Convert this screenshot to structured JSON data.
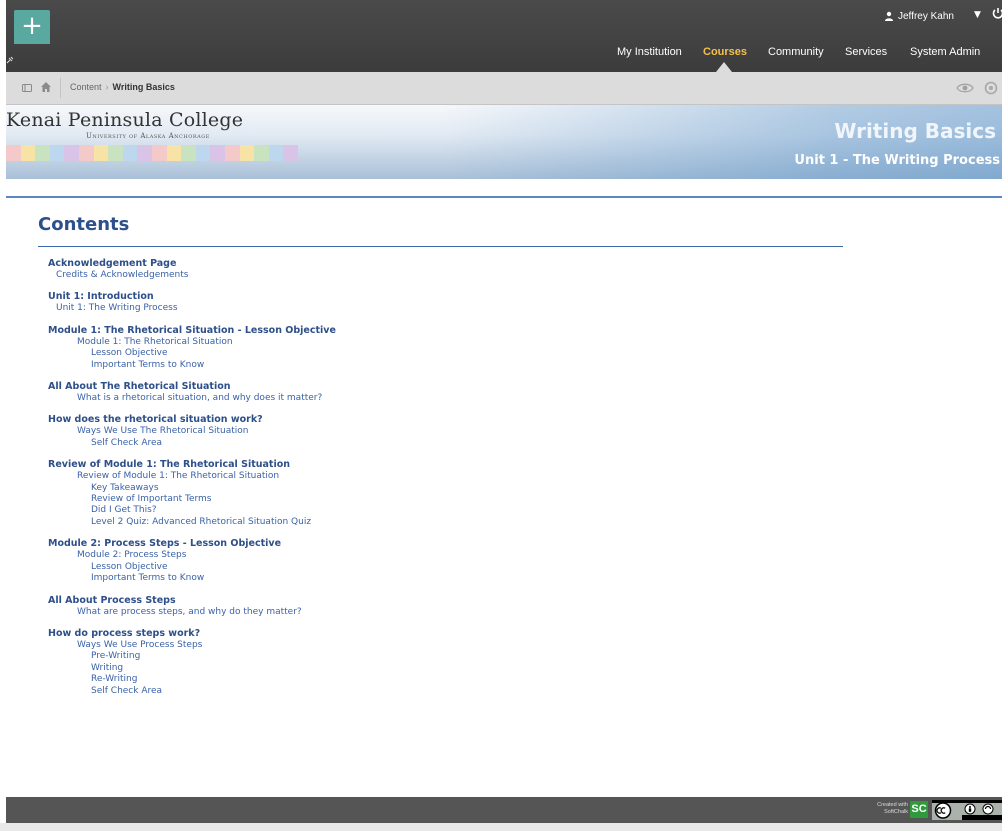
{
  "user": {
    "name": "Jeffrey Kahn"
  },
  "nav": {
    "tabs": [
      {
        "label": "My Institution",
        "active": false
      },
      {
        "label": "Courses",
        "active": true
      },
      {
        "label": "Community",
        "active": false
      },
      {
        "label": "Services",
        "active": false
      },
      {
        "label": "System Admin",
        "active": false
      }
    ]
  },
  "breadcrumb": {
    "parent": "Content",
    "separator": "›",
    "current": "Writing Basics"
  },
  "banner": {
    "college_name": "Kenai Peninsula College",
    "college_subtitle": "University of Alaska Anchorage",
    "course_title": "Writing Basics",
    "unit_title": "Unit 1 - The Writing Process",
    "strip_colors": [
      "#f4c9c9",
      "#f7e3a6",
      "#c9e3c0",
      "#bcd7ee",
      "#d9c3e6",
      "#f4c9c9",
      "#f7e3a6",
      "#c9e3c0",
      "#bcd7ee",
      "#d9c3e6",
      "#f4c9c9",
      "#f7e3a6",
      "#c9e3c0",
      "#bcd7ee",
      "#d9c3e6",
      "#f4c9c9",
      "#f7e3a6",
      "#c9e3c0",
      "#bcd7ee",
      "#d9c3e6"
    ]
  },
  "contents": {
    "heading": "Contents",
    "sections": [
      {
        "title": "Acknowledgement Page",
        "items": [
          {
            "label": "Credits & Acknowledgements",
            "level": 1
          }
        ]
      },
      {
        "title": "Unit 1: Introduction",
        "items": [
          {
            "label": "Unit 1: The Writing Process",
            "level": 1
          }
        ]
      },
      {
        "title": "Module 1: The Rhetorical Situation - Lesson Objective",
        "items": [
          {
            "label": "Module 1: The Rhetorical Situation",
            "level": 2
          },
          {
            "label": "Lesson Objective",
            "level": 3
          },
          {
            "label": "Important Terms to Know",
            "level": 3
          }
        ]
      },
      {
        "title": "All About The Rhetorical Situation",
        "items": [
          {
            "label": "What is a rhetorical situation, and why does it matter?",
            "level": 2
          }
        ]
      },
      {
        "title": "How does the rhetorical situation work?",
        "items": [
          {
            "label": "Ways We Use The Rhetorical Situation",
            "level": 2
          },
          {
            "label": "Self Check Area",
            "level": 3
          }
        ]
      },
      {
        "title": "Review of Module 1: The Rhetorical Situation",
        "items": [
          {
            "label": "Review of Module 1: The Rhetorical Situation",
            "level": 2
          },
          {
            "label": "Key Takeaways",
            "level": 3
          },
          {
            "label": "Review of Important Terms",
            "level": 3
          },
          {
            "label": "Did I Get This?",
            "level": 3
          },
          {
            "label": "Level 2 Quiz: Advanced Rhetorical Situation Quiz",
            "level": 3
          }
        ]
      },
      {
        "title": "Module 2: Process Steps - Lesson Objective",
        "items": [
          {
            "label": "Module 2: Process Steps",
            "level": 2
          },
          {
            "label": "Lesson Objective",
            "level": 3
          },
          {
            "label": "Important Terms to Know",
            "level": 3
          }
        ]
      },
      {
        "title": "All About Process Steps",
        "items": [
          {
            "label": "What are process steps, and why do they matter?",
            "level": 2
          }
        ]
      },
      {
        "title": "How do process steps work?",
        "items": [
          {
            "label": "Ways We Use Process Steps",
            "level": 2
          },
          {
            "label": "Pre-Writing",
            "level": 3
          },
          {
            "label": "Writing",
            "level": 3
          },
          {
            "label": "Re-Writing",
            "level": 3
          },
          {
            "label": "Self Check Area",
            "level": 3
          }
        ]
      }
    ]
  },
  "footer": {
    "created_with_line1": "Created with",
    "created_with_line2": "SoftChalk",
    "sc_logo": "SC"
  },
  "icons": {
    "plus": "plus-icon",
    "pin": "pin-icon",
    "user": "person-icon",
    "power": "power-icon",
    "menu": "menu-icon",
    "home": "home-icon",
    "eye": "eye-icon",
    "gear": "gear-icon",
    "license": "creative-commons-icon"
  }
}
